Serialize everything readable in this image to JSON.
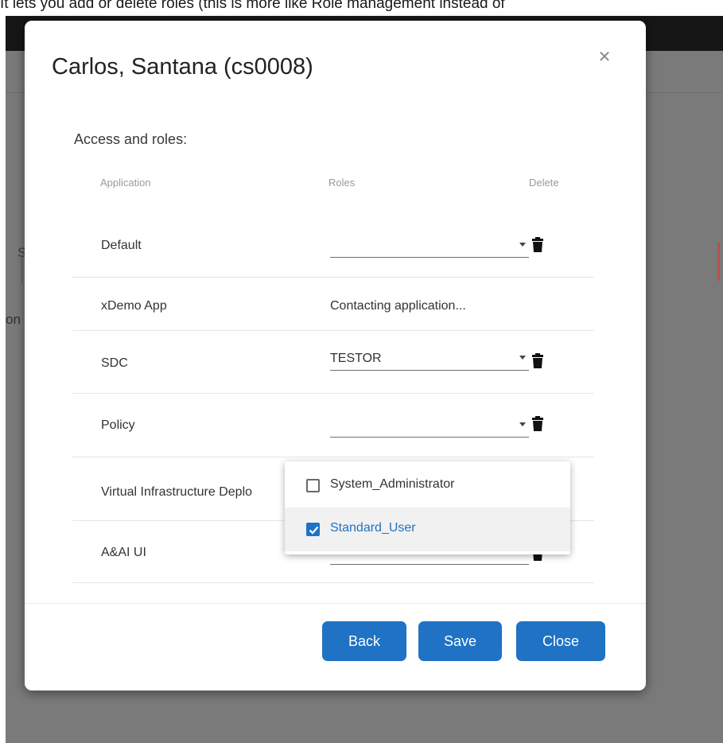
{
  "caption": "It lets you add or delete roles (this is more like Role management instead of",
  "background": {
    "left_letter": "S",
    "left_text_fragment": "on"
  },
  "modal": {
    "title": "Carlos, Santana (cs0008)",
    "close_icon": "close-icon",
    "section_label": "Access and roles:",
    "columns": {
      "application": "Application",
      "roles": "Roles",
      "delete": "Delete"
    },
    "rows": [
      {
        "application": "Default",
        "role": ""
      },
      {
        "application": "xDemo App",
        "status": "Contacting application..."
      },
      {
        "application": "SDC",
        "role": "TESTOR"
      },
      {
        "application": "Policy",
        "role": ""
      },
      {
        "application": "Virtual Infrastructure Deplo",
        "role": ""
      },
      {
        "application": "A&AI UI",
        "role": ""
      }
    ],
    "dropdown": {
      "options": [
        {
          "label": "System_Administrator",
          "checked": false
        },
        {
          "label": "Standard_User",
          "checked": true
        }
      ]
    },
    "buttons": {
      "back": "Back",
      "save": "Save",
      "close": "Close"
    }
  },
  "colors": {
    "accent": "#1f72c4",
    "backdrop": "#7a7a7a",
    "topbar": "#161616"
  }
}
